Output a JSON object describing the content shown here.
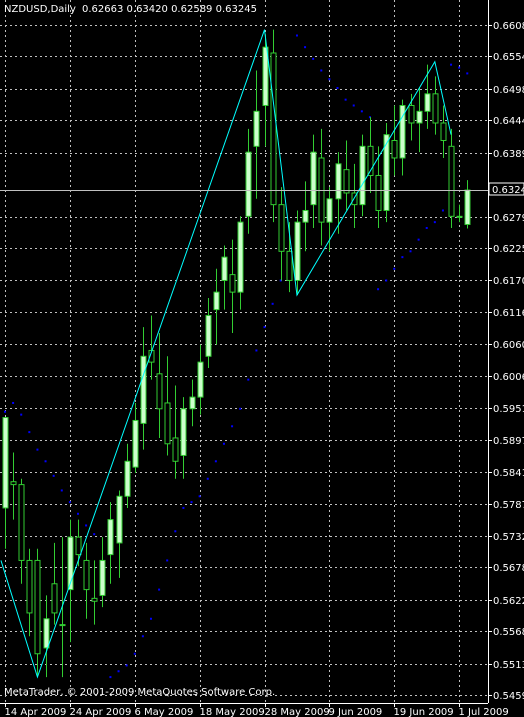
{
  "header": {
    "symbol": "NZDUSD,Daily",
    "ohlc": "0.62663 0.63420 0.62589 0.63245"
  },
  "footer": {
    "copyright": "MetaTrader, © 2001-2009 MetaQuotes Software Corp."
  },
  "colors": {
    "background": "#000000",
    "grid": "#c0c0c0",
    "bull_candle": "#ccffcc",
    "bear_candle": "#000000",
    "candle_wick": "#32cd32",
    "zigzag": "#00ffff",
    "sar": "#0000ff",
    "price_line": "#c0c0c0",
    "text": "#ffffff"
  },
  "chart_data": {
    "type": "candlestick",
    "indicators": [
      "Parabolic SAR",
      "ZigZag"
    ],
    "ylim": [
      0.5449,
      0.6608
    ],
    "ytick_labels": [
      "0.66080",
      "0.65540",
      "0.64985",
      "0.64445",
      "0.63890",
      "0.63245",
      "0.62795",
      "0.62255",
      "0.61700",
      "0.61160",
      "0.60605",
      "0.60065",
      "0.59510",
      "0.58970",
      "0.58415",
      "0.57875",
      "0.57320",
      "0.56780",
      "0.56225",
      "0.55685",
      "0.55130",
      "0.54590"
    ],
    "current_price": "0.63245",
    "xtick_labels": [
      {
        "label": "14 Apr 2009",
        "index": 0
      },
      {
        "label": "24 Apr 2009",
        "index": 8
      },
      {
        "label": "6 May 2009",
        "index": 16
      },
      {
        "label": "18 May 2009",
        "index": 24
      },
      {
        "label": "28 May 2009",
        "index": 32
      },
      {
        "label": "9 Jun 2009",
        "index": 40
      },
      {
        "label": "19 Jun 2009",
        "index": 48
      },
      {
        "label": "1 Jul 2009",
        "index": 56
      }
    ],
    "candles": [
      {
        "o": 0.578,
        "h": 0.5935,
        "l": 0.571,
        "c": 0.5935
      },
      {
        "o": 0.5825,
        "h": 0.5875,
        "l": 0.576,
        "c": 0.582
      },
      {
        "o": 0.582,
        "h": 0.583,
        "l": 0.565,
        "c": 0.569
      },
      {
        "o": 0.569,
        "h": 0.571,
        "l": 0.556,
        "c": 0.56
      },
      {
        "o": 0.569,
        "h": 0.571,
        "l": 0.549,
        "c": 0.553
      },
      {
        "o": 0.554,
        "h": 0.563,
        "l": 0.549,
        "c": 0.559
      },
      {
        "o": 0.565,
        "h": 0.572,
        "l": 0.558,
        "c": 0.56
      },
      {
        "o": 0.558,
        "h": 0.573,
        "l": 0.549,
        "c": 0.558
      },
      {
        "o": 0.564,
        "h": 0.576,
        "l": 0.555,
        "c": 0.573
      },
      {
        "o": 0.573,
        "h": 0.576,
        "l": 0.568,
        "c": 0.57
      },
      {
        "o": 0.569,
        "h": 0.572,
        "l": 0.559,
        "c": 0.564
      },
      {
        "o": 0.5625,
        "h": 0.569,
        "l": 0.558,
        "c": 0.562
      },
      {
        "o": 0.563,
        "h": 0.573,
        "l": 0.561,
        "c": 0.569
      },
      {
        "o": 0.57,
        "h": 0.579,
        "l": 0.565,
        "c": 0.576
      },
      {
        "o": 0.572,
        "h": 0.581,
        "l": 0.566,
        "c": 0.58
      },
      {
        "o": 0.58,
        "h": 0.589,
        "l": 0.578,
        "c": 0.586
      },
      {
        "o": 0.585,
        "h": 0.596,
        "l": 0.584,
        "c": 0.593
      },
      {
        "o": 0.5925,
        "h": 0.609,
        "l": 0.588,
        "c": 0.604
      },
      {
        "o": 0.605,
        "h": 0.611,
        "l": 0.6,
        "c": 0.603
      },
      {
        "o": 0.601,
        "h": 0.608,
        "l": 0.59,
        "c": 0.595
      },
      {
        "o": 0.596,
        "h": 0.604,
        "l": 0.587,
        "c": 0.589
      },
      {
        "o": 0.59,
        "h": 0.599,
        "l": 0.583,
        "c": 0.586
      },
      {
        "o": 0.587,
        "h": 0.597,
        "l": 0.583,
        "c": 0.595
      },
      {
        "o": 0.595,
        "h": 0.6,
        "l": 0.592,
        "c": 0.597
      },
      {
        "o": 0.597,
        "h": 0.606,
        "l": 0.594,
        "c": 0.603
      },
      {
        "o": 0.604,
        "h": 0.614,
        "l": 0.602,
        "c": 0.611
      },
      {
        "o": 0.612,
        "h": 0.619,
        "l": 0.606,
        "c": 0.615
      },
      {
        "o": 0.617,
        "h": 0.623,
        "l": 0.612,
        "c": 0.621
      },
      {
        "o": 0.618,
        "h": 0.624,
        "l": 0.608,
        "c": 0.615
      },
      {
        "o": 0.615,
        "h": 0.628,
        "l": 0.612,
        "c": 0.627
      },
      {
        "o": 0.628,
        "h": 0.643,
        "l": 0.625,
        "c": 0.639
      },
      {
        "o": 0.64,
        "h": 0.653,
        "l": 0.631,
        "c": 0.646
      },
      {
        "o": 0.647,
        "h": 0.6592,
        "l": 0.64,
        "c": 0.657
      },
      {
        "o": 0.656,
        "h": 0.66,
        "l": 0.627,
        "c": 0.63
      },
      {
        "o": 0.63,
        "h": 0.633,
        "l": 0.617,
        "c": 0.622
      },
      {
        "o": 0.622,
        "h": 0.627,
        "l": 0.615,
        "c": 0.617
      },
      {
        "o": 0.617,
        "h": 0.629,
        "l": 0.6145,
        "c": 0.627
      },
      {
        "o": 0.627,
        "h": 0.634,
        "l": 0.622,
        "c": 0.629
      },
      {
        "o": 0.63,
        "h": 0.642,
        "l": 0.626,
        "c": 0.639
      },
      {
        "o": 0.638,
        "h": 0.643,
        "l": 0.623,
        "c": 0.627
      },
      {
        "o": 0.627,
        "h": 0.633,
        "l": 0.622,
        "c": 0.631
      },
      {
        "o": 0.631,
        "h": 0.639,
        "l": 0.625,
        "c": 0.637
      },
      {
        "o": 0.636,
        "h": 0.641,
        "l": 0.629,
        "c": 0.632
      },
      {
        "o": 0.632,
        "h": 0.637,
        "l": 0.626,
        "c": 0.63
      },
      {
        "o": 0.63,
        "h": 0.642,
        "l": 0.628,
        "c": 0.64
      },
      {
        "o": 0.64,
        "h": 0.645,
        "l": 0.632,
        "c": 0.635
      },
      {
        "o": 0.635,
        "h": 0.64,
        "l": 0.626,
        "c": 0.629
      },
      {
        "o": 0.629,
        "h": 0.644,
        "l": 0.627,
        "c": 0.642
      },
      {
        "o": 0.641,
        "h": 0.647,
        "l": 0.635,
        "c": 0.638
      },
      {
        "o": 0.638,
        "h": 0.648,
        "l": 0.635,
        "c": 0.647
      },
      {
        "o": 0.647,
        "h": 0.649,
        "l": 0.641,
        "c": 0.644
      },
      {
        "o": 0.644,
        "h": 0.65,
        "l": 0.639,
        "c": 0.646
      },
      {
        "o": 0.646,
        "h": 0.654,
        "l": 0.643,
        "c": 0.649
      },
      {
        "o": 0.649,
        "h": 0.652,
        "l": 0.642,
        "c": 0.644
      },
      {
        "o": 0.644,
        "h": 0.647,
        "l": 0.638,
        "c": 0.641
      },
      {
        "o": 0.64,
        "h": 0.643,
        "l": 0.626,
        "c": 0.628
      },
      {
        "o": 0.628,
        "h": 0.63,
        "l": 0.627,
        "c": 0.628
      },
      {
        "o": 0.6266,
        "h": 0.6342,
        "l": 0.6259,
        "c": 0.6325
      }
    ],
    "sar": [
      {
        "i": 0,
        "v": 0.5945
      },
      {
        "i": 1,
        "v": 0.596
      },
      {
        "i": 2,
        "v": 0.594
      },
      {
        "i": 3,
        "v": 0.591
      },
      {
        "i": 4,
        "v": 0.588
      },
      {
        "i": 5,
        "v": 0.586
      },
      {
        "i": 6,
        "v": 0.5835
      },
      {
        "i": 7,
        "v": 0.581
      },
      {
        "i": 8,
        "v": 0.579
      },
      {
        "i": 9,
        "v": 0.577
      },
      {
        "i": 10,
        "v": 0.575
      },
      {
        "i": 11,
        "v": 0.5735
      },
      {
        "i": 13,
        "v": 0.549
      },
      {
        "i": 14,
        "v": 0.55
      },
      {
        "i": 15,
        "v": 0.551
      },
      {
        "i": 16,
        "v": 0.553
      },
      {
        "i": 17,
        "v": 0.556
      },
      {
        "i": 18,
        "v": 0.559
      },
      {
        "i": 19,
        "v": 0.564
      },
      {
        "i": 20,
        "v": 0.569
      },
      {
        "i": 21,
        "v": 0.574
      },
      {
        "i": 22,
        "v": 0.578
      },
      {
        "i": 23,
        "v": 0.579
      },
      {
        "i": 24,
        "v": 0.58
      },
      {
        "i": 25,
        "v": 0.583
      },
      {
        "i": 26,
        "v": 0.586
      },
      {
        "i": 27,
        "v": 0.589
      },
      {
        "i": 28,
        "v": 0.592
      },
      {
        "i": 29,
        "v": 0.595
      },
      {
        "i": 30,
        "v": 0.6
      },
      {
        "i": 31,
        "v": 0.605
      },
      {
        "i": 32,
        "v": 0.609
      },
      {
        "i": 33,
        "v": 0.613
      },
      {
        "i": 34,
        "v": 0.617
      },
      {
        "i": 35,
        "v": 0.621
      },
      {
        "i": 36,
        "v": 0.659
      },
      {
        "i": 37,
        "v": 0.657
      },
      {
        "i": 38,
        "v": 0.655
      },
      {
        "i": 39,
        "v": 0.653
      },
      {
        "i": 40,
        "v": 0.6515
      },
      {
        "i": 41,
        "v": 0.65
      },
      {
        "i": 42,
        "v": 0.648
      },
      {
        "i": 43,
        "v": 0.647
      },
      {
        "i": 44,
        "v": 0.646
      },
      {
        "i": 45,
        "v": 0.645
      },
      {
        "i": 46,
        "v": 0.6155
      },
      {
        "i": 47,
        "v": 0.617
      },
      {
        "i": 48,
        "v": 0.619
      },
      {
        "i": 49,
        "v": 0.621
      },
      {
        "i": 50,
        "v": 0.622
      },
      {
        "i": 51,
        "v": 0.624
      },
      {
        "i": 52,
        "v": 0.626
      },
      {
        "i": 53,
        "v": 0.627
      },
      {
        "i": 54,
        "v": 0.629
      },
      {
        "i": 55,
        "v": 0.654
      },
      {
        "i": 56,
        "v": 0.6535
      },
      {
        "i": 57,
        "v": 0.6525
      }
    ],
    "zigzag": [
      {
        "i": -0.5,
        "v": 0.569
      },
      {
        "i": 4,
        "v": 0.549
      },
      {
        "i": 32,
        "v": 0.66
      },
      {
        "i": 36,
        "v": 0.6145
      },
      {
        "i": 53,
        "v": 0.6545
      },
      {
        "i": 55,
        "v": 0.642
      }
    ]
  }
}
